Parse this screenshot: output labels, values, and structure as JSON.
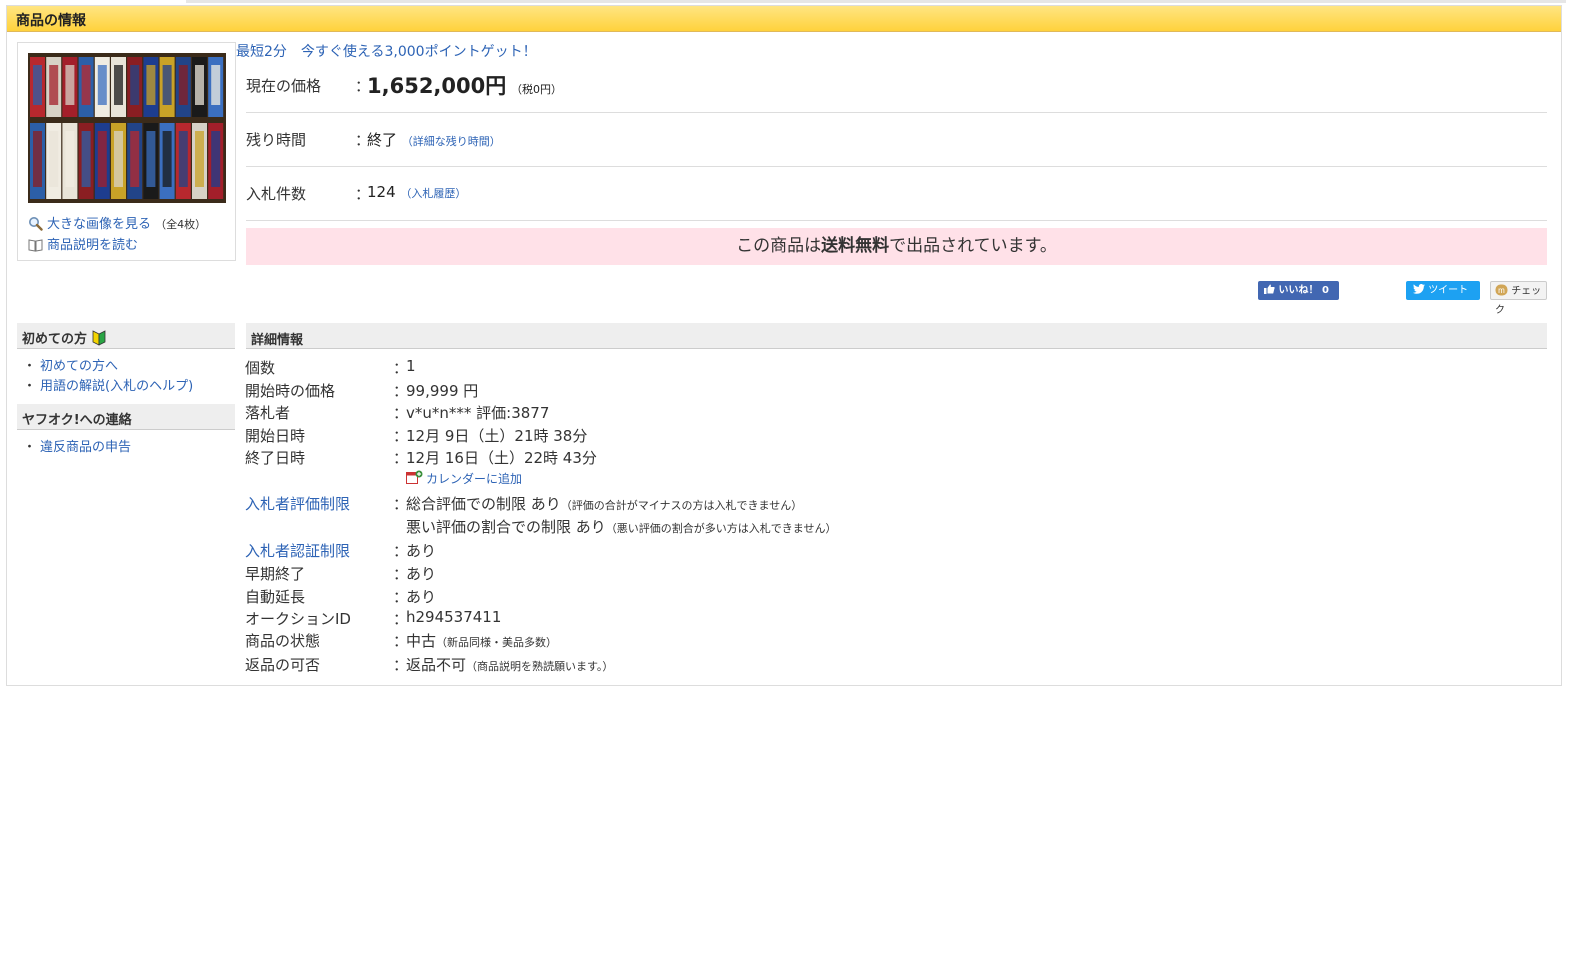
{
  "header": {
    "title": "商品の情報"
  },
  "image": {
    "view_large_label": "大きな画像を見る",
    "image_count": "（全4枚）",
    "read_description_label": "商品説明を読む"
  },
  "promo": {
    "text": "最短2分　今すぐ使える3,000ポイントゲット！"
  },
  "info": {
    "price_label": "現在の価格",
    "price_value": "1,652,000円",
    "tax_note": "（税0円）",
    "time_label": "残り時間",
    "time_value": "終了",
    "time_link": "（詳細な残り時間）",
    "bids_label": "入札件数",
    "bids_value": "124",
    "bids_link": "（入札履歴）",
    "colon": "："
  },
  "shipping": {
    "prefix": "この商品は",
    "bold": "送料無料",
    "suffix": "で出品されています。"
  },
  "social": {
    "like_label": "いいね！ 0",
    "tweet_label": "ツイート",
    "check_label": "チェック"
  },
  "sidebar": {
    "beginners_title": "初めての方",
    "beginners_items": [
      "初めての方へ",
      "用語の解説(入札のヘルプ)"
    ],
    "contact_title": "ヤフオク!への連絡",
    "contact_items": [
      "違反商品の申告"
    ],
    "bullet": "・"
  },
  "details": {
    "title": "詳細情報",
    "colon": "：",
    "quantity_label": "個数",
    "quantity_value": "1",
    "start_price_label": "開始時の価格",
    "start_price_value": "99,999 円",
    "winner_label": "落札者",
    "winner_value": "v*u*n*** 評価:3877",
    "start_date_label": "開始日時",
    "start_date_value": "12月 9日（土）21時 38分",
    "end_date_label": "終了日時",
    "end_date_value": "12月 16日（土）22時 43分",
    "calendar_link": "カレンダーに追加",
    "rating_limit_label": "入札者評価制限",
    "rating_limit_value1": "総合評価での制限 あり",
    "rating_limit_note1": "（評価の合計がマイナスの方は入札できません）",
    "rating_limit_value2": "悪い評価の割合での制限 あり",
    "rating_limit_note2": "（悪い評価の割合が多い方は入札できません）",
    "auth_limit_label": "入札者認証制限",
    "auth_limit_value": "あり",
    "early_end_label": "早期終了",
    "early_end_value": "あり",
    "auto_extend_label": "自動延長",
    "auto_extend_value": "あり",
    "auction_id_label": "オークションID",
    "auction_id_value": "h294537411",
    "condition_label": "商品の状態",
    "condition_value": "中古",
    "condition_note": "（新品同様・美品多数）",
    "returns_label": "返品の可否",
    "returns_value": "返品不可",
    "returns_note": "（商品説明を熟読願います。）"
  },
  "colors": {
    "header_yellow": "#ffd23c",
    "link_blue": "#2d63b5",
    "ship_pink": "#ffe1e8"
  }
}
